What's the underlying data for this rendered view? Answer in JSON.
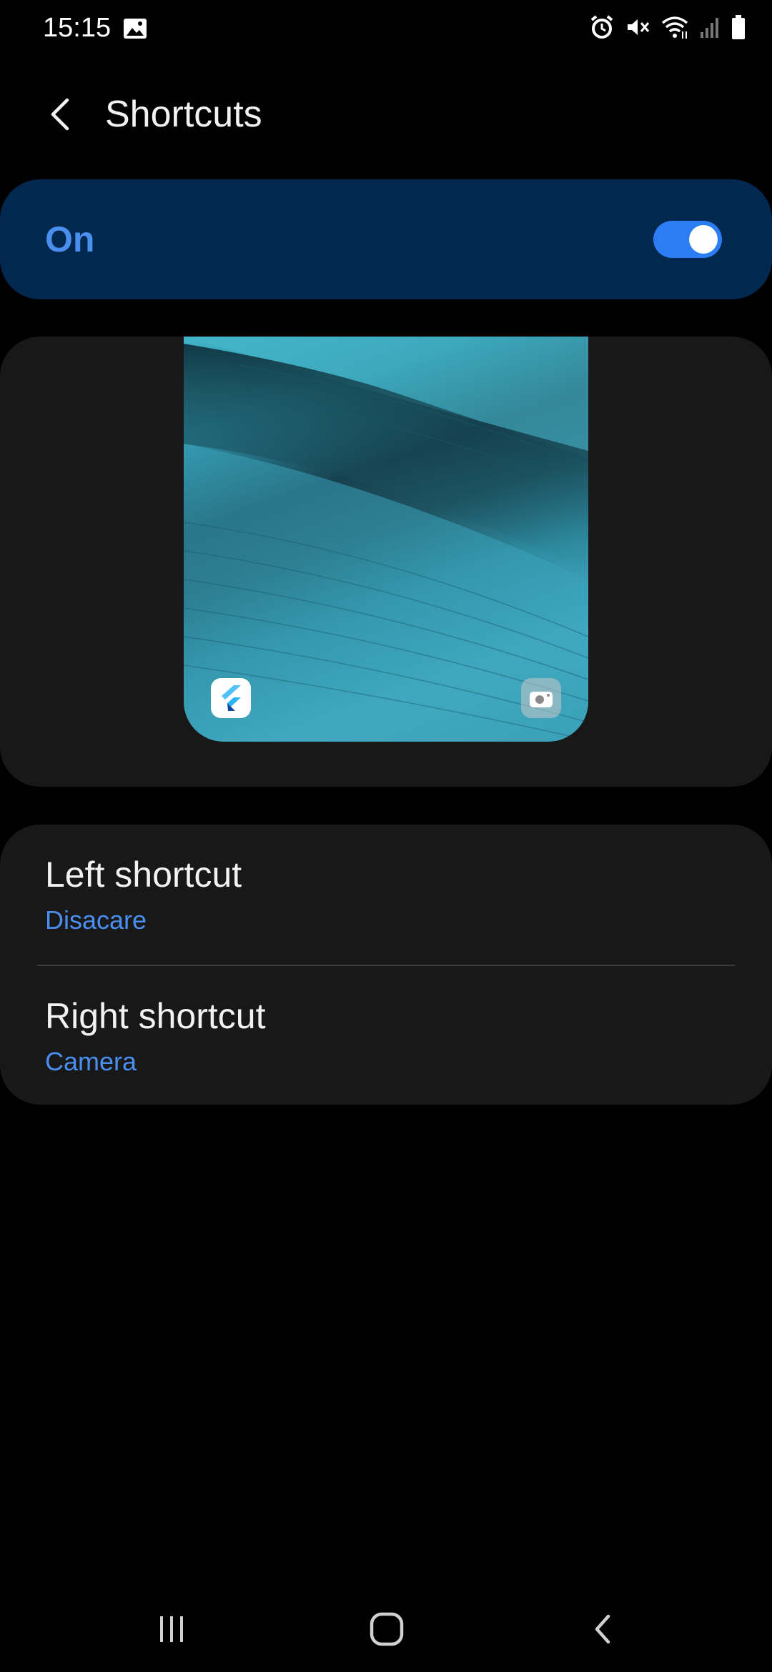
{
  "status_bar": {
    "time": "15:15",
    "icons": [
      "gallery-icon",
      "alarm-icon",
      "mute-vibrate-icon",
      "wifi-icon",
      "signal-icon",
      "battery-icon"
    ]
  },
  "header": {
    "back_icon": "back-chevron-icon",
    "title": "Shortcuts"
  },
  "master_toggle": {
    "label": "On",
    "state": true,
    "accent_color": "#2a7df2",
    "background_color": "#03284f"
  },
  "preview": {
    "left_shortcut_icon": "flutter-app-icon",
    "right_shortcut_icon": "camera-icon"
  },
  "options": [
    {
      "title": "Left shortcut",
      "value": "Disacare"
    },
    {
      "title": "Right shortcut",
      "value": "Camera"
    }
  ],
  "nav_bar": {
    "recents_icon": "recents-icon",
    "home_icon": "home-icon",
    "back_icon": "back-icon"
  },
  "colors": {
    "background": "#000000",
    "card": "#181818",
    "accent_text": "#4a8ff0"
  }
}
